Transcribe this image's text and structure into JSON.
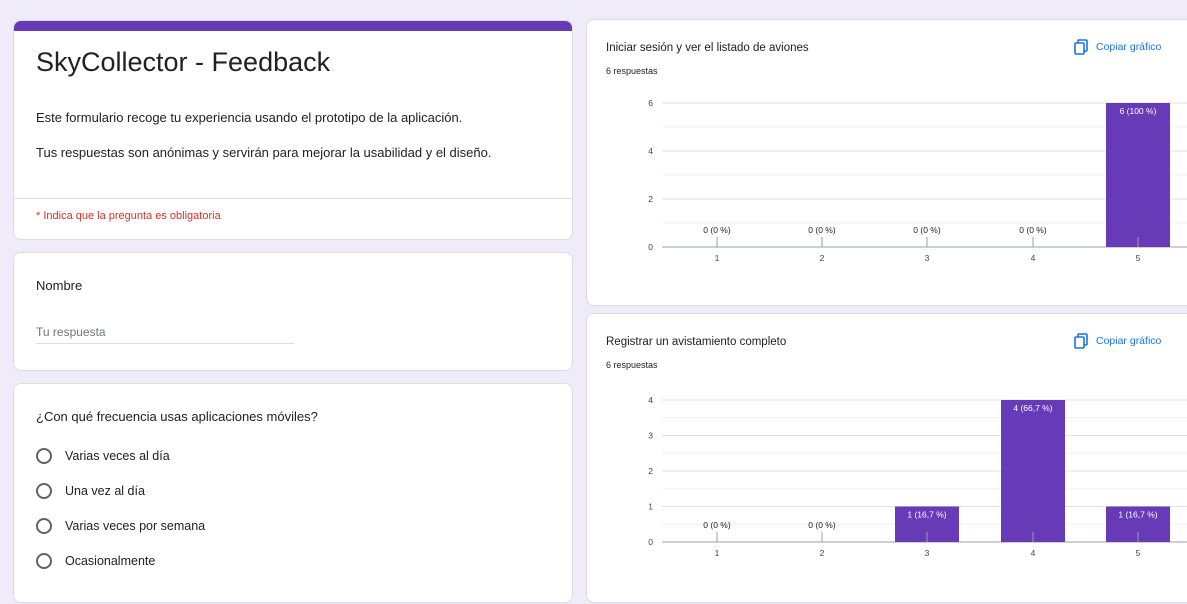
{
  "form": {
    "title": "SkyCollector - Feedback",
    "description_1": "Este formulario recoge tu experiencia usando el prototipo de la aplicación.",
    "description_2": "Tus respuestas son anónimas y servirán para mejorar la usabilidad y el diseño.",
    "required_note": "* Indica que la pregunta es obligatoria",
    "accent_color": "#673ab7",
    "required_color": "#d93025"
  },
  "name_question": {
    "label": "Nombre",
    "placeholder": "Tu respuesta",
    "value": ""
  },
  "frequency_question": {
    "label": "¿Con qué frecuencia usas aplicaciones móviles?",
    "options": [
      "Varias veces al día",
      "Una vez al día",
      "Varias veces por semana",
      "Ocasionalmente"
    ]
  },
  "charts": {
    "copy_label": "Copiar gráfico",
    "copy_icon": "copy-icon",
    "link_color": "#1a73e8",
    "bar_color": "#673ab7",
    "chart1": {
      "title": "Iniciar sesión y ver el listado de aviones",
      "subtitle": "6 respuestas"
    },
    "chart2": {
      "title": "Registrar un avistamiento completo",
      "subtitle": "6 respuestas"
    }
  },
  "chart_data": [
    {
      "type": "bar",
      "title": "Iniciar sesión y ver el listado de aviones",
      "categories": [
        "1",
        "2",
        "3",
        "4",
        "5"
      ],
      "values": [
        0,
        0,
        0,
        0,
        6
      ],
      "labels": [
        "0 (0 %)",
        "0 (0 %)",
        "0 (0 %)",
        "0 (0 %)",
        "6 (100 %)"
      ],
      "yticks": [
        0,
        2,
        4,
        6
      ],
      "ylim": [
        0,
        6
      ],
      "grid": true
    },
    {
      "type": "bar",
      "title": "Registrar un avistamiento completo",
      "categories": [
        "1",
        "2",
        "3",
        "4",
        "5"
      ],
      "values": [
        0,
        0,
        1,
        4,
        1
      ],
      "labels": [
        "0 (0 %)",
        "0 (0 %)",
        "1 (16,7 %)",
        "4 (66,7 %)",
        "1 (16,7 %)"
      ],
      "yticks": [
        0,
        1,
        2,
        3,
        4
      ],
      "ylim": [
        0,
        4
      ],
      "grid": true
    }
  ]
}
